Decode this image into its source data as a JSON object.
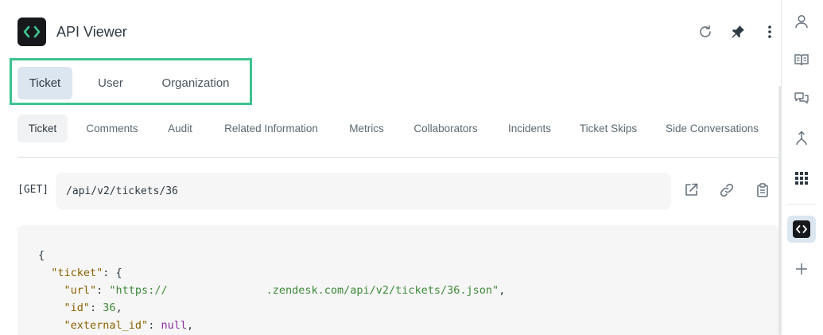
{
  "app": {
    "title": "API Viewer",
    "logo_icon": "code-brackets-icon"
  },
  "header": {
    "buttons": [
      {
        "name": "refresh-icon"
      },
      {
        "name": "pin-icon"
      },
      {
        "name": "more-vertical-icon"
      }
    ]
  },
  "primary_tabs": [
    {
      "label": "Ticket",
      "active": true
    },
    {
      "label": "User",
      "active": false
    },
    {
      "label": "Organization",
      "active": false
    }
  ],
  "secondary_tabs": [
    {
      "label": "Ticket",
      "active": true
    },
    {
      "label": "Comments"
    },
    {
      "label": "Audit"
    },
    {
      "label": "Related Information"
    },
    {
      "label": "Metrics"
    },
    {
      "label": "Collaborators"
    },
    {
      "label": "Incidents"
    },
    {
      "label": "Ticket Skips"
    },
    {
      "label": "Side Conversations"
    }
  ],
  "request": {
    "method": "[GET]",
    "path": "/api/v2/tickets/36",
    "actions": [
      "external-link-icon",
      "link-icon",
      "clipboard-icon"
    ]
  },
  "response": {
    "open_brace": "{",
    "ticket_key": "\"ticket\"",
    "ticket_open": ": {",
    "url_key": "\"url\"",
    "url_value_prefix": "\"https://",
    "url_value_suffix": ".zendesk.com/api/v2/tickets/36.json\"",
    "id_key": "\"id\"",
    "id_value": "36",
    "external_id_key": "\"external_id\"",
    "external_id_value": "null"
  },
  "rail": {
    "items": [
      "user-icon",
      "book-icon",
      "chat-icon",
      "merge-icon",
      "apps-grid-icon",
      "code-brackets-icon",
      "plus-icon"
    ],
    "active": "code-brackets-icon"
  },
  "colors": {
    "accent_outline": "#3fc38f",
    "active_tab_bg": "#dbe6f1",
    "json_key": "#8a6100",
    "json_string": "#3d8a3a",
    "json_null": "#8b2fa0"
  }
}
